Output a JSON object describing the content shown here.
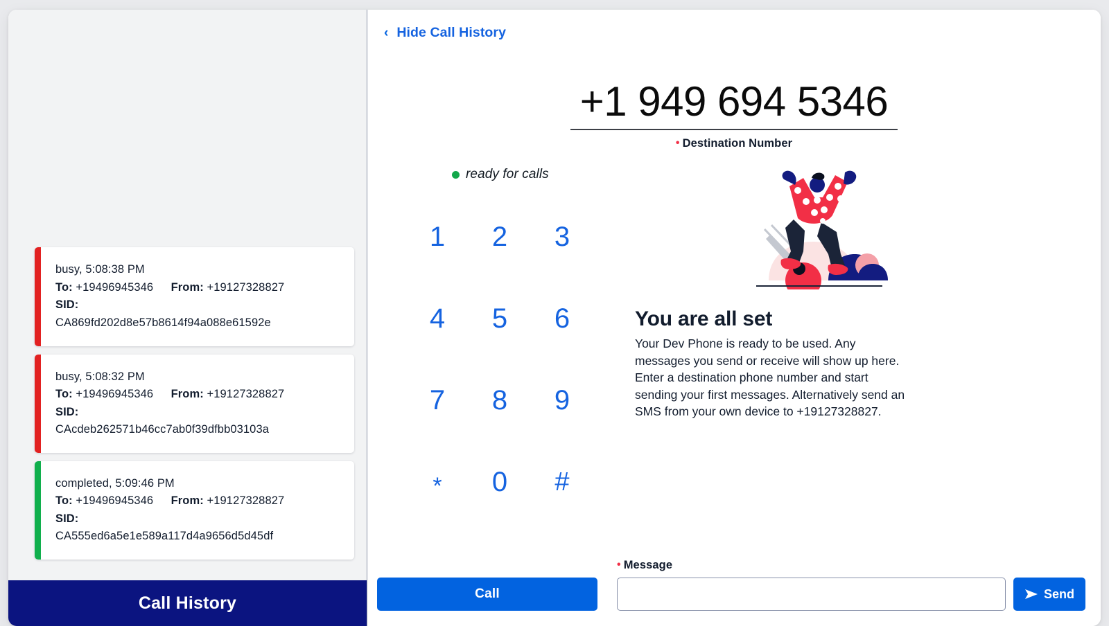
{
  "window": {
    "background_color": "#e9eaed",
    "panel_color": "#ffffff"
  },
  "colors": {
    "accent_blue": "#0263e0",
    "link_blue": "#1563e0",
    "navy": "#0b1480",
    "status_red": "#e22121",
    "status_green": "#10af4c",
    "required_red": "#f22f46",
    "text_dark": "#121c2d"
  },
  "history_panel": {
    "footer_label": "Call History",
    "calls": [
      {
        "status": "busy",
        "status_time": "busy, 5:08:38 PM",
        "to_label": "To:",
        "to_value": "+19496945346",
        "from_label": "From:",
        "from_value": "+19127328827",
        "sid_label": "SID:",
        "sid_value": "CA869fd202d8e57b8614f94a088e61592e"
      },
      {
        "status": "busy",
        "status_time": "busy, 5:08:32 PM",
        "to_label": "To:",
        "to_value": "+19496945346",
        "from_label": "From:",
        "from_value": "+19127328827",
        "sid_label": "SID:",
        "sid_value": "CAcdeb262571b46cc7ab0f39dfbb03103a"
      },
      {
        "status": "completed",
        "status_time": "completed, 5:09:46 PM",
        "to_label": "To:",
        "to_value": "+19496945346",
        "from_label": "From:",
        "from_value": "+19127328827",
        "sid_label": "SID:",
        "sid_value": "CA555ed6a5e1e589a117d4a9656d5d45df"
      }
    ]
  },
  "phone_panel": {
    "hide_history_label": "Hide Call History",
    "chevron_glyph": "‹",
    "destination": {
      "number": "+1 949 694 5346",
      "label": "Destination Number",
      "required_marker": "•"
    },
    "status": {
      "text": "ready for calls",
      "dot_color": "#13a84b"
    },
    "dialpad": {
      "keys": [
        "1",
        "2",
        "3",
        "4",
        "5",
        "6",
        "7",
        "8",
        "9",
        "*",
        "0",
        "#"
      ]
    },
    "info": {
      "title": "You are all set",
      "body": "Your Dev Phone is ready to be used. Any messages you send or receive will show up here. Enter a destination phone number and start sending your first messages. Alternatively send an SMS from your own device to +19127328827."
    },
    "actions": {
      "call_label": "Call",
      "message_label": "Message",
      "message_required_marker": "•",
      "message_value": "",
      "message_placeholder": "",
      "send_label": "Send"
    }
  }
}
